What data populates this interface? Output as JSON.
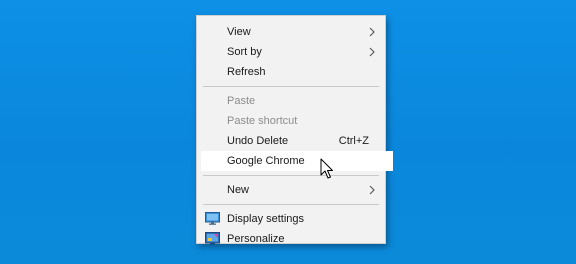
{
  "menu": {
    "items": [
      {
        "label": "View",
        "icon": "",
        "shortcut": "",
        "submenu": true,
        "disabled": false
      },
      {
        "label": "Sort by",
        "icon": "",
        "shortcut": "",
        "submenu": true,
        "disabled": false
      },
      {
        "label": "Refresh",
        "icon": "",
        "shortcut": "",
        "submenu": false,
        "disabled": false
      },
      {
        "label": "Paste",
        "icon": "",
        "shortcut": "",
        "submenu": false,
        "disabled": true
      },
      {
        "label": "Paste shortcut",
        "icon": "",
        "shortcut": "",
        "submenu": false,
        "disabled": true
      },
      {
        "label": "Undo Delete",
        "icon": "",
        "shortcut": "Ctrl+Z",
        "submenu": false,
        "disabled": false
      },
      {
        "label": "Google Chrome",
        "icon": "",
        "shortcut": "",
        "submenu": false,
        "disabled": false,
        "hovered": true
      },
      {
        "label": "New",
        "icon": "",
        "shortcut": "",
        "submenu": true,
        "disabled": false
      },
      {
        "label": "Display settings",
        "icon": "display-settings-icon",
        "shortcut": "",
        "submenu": false,
        "disabled": false
      },
      {
        "label": "Personalize",
        "icon": "personalize-icon",
        "shortcut": "",
        "submenu": false,
        "disabled": false
      }
    ]
  },
  "colors": {
    "desktop": "#0a8ae0",
    "menu_bg": "#f2f2f2",
    "hover_bg": "#ffffff",
    "disabled_text": "#8c8c8c"
  }
}
